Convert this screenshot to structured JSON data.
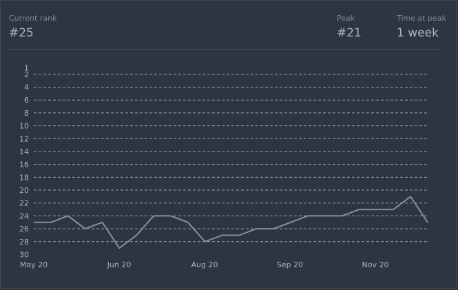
{
  "stats": {
    "current_rank": {
      "label": "Current rank",
      "value": "#25"
    },
    "peak": {
      "label": "Peak",
      "value": "#21"
    },
    "time_at_peak": {
      "label": "Time at peak",
      "value": "1 week"
    }
  },
  "chart_data": {
    "type": "line",
    "title": "",
    "xlabel": "",
    "ylabel": "",
    "y_axis_inverted": true,
    "ylim": [
      1,
      30
    ],
    "y_ticks": [
      1,
      2,
      4,
      6,
      8,
      10,
      12,
      14,
      16,
      18,
      20,
      22,
      24,
      26,
      28,
      30
    ],
    "x_ticks": [
      "May 20",
      "Jun 20",
      "Aug 20",
      "Sep 20",
      "Nov 20"
    ],
    "grid": true,
    "series": [
      {
        "color": "#8c8f92",
        "values": [
          25,
          25,
          24,
          26,
          25,
          29,
          27,
          24,
          24,
          25,
          28,
          27,
          27,
          26,
          26,
          25,
          24,
          24,
          24,
          23,
          23,
          23,
          21,
          25
        ]
      }
    ]
  }
}
